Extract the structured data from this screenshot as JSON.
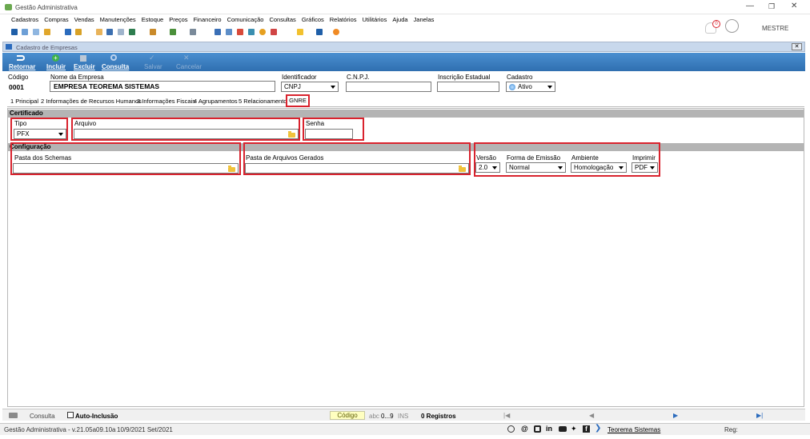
{
  "window": {
    "title": "Gestão Administrativa"
  },
  "menu": [
    "Cadastros",
    "Compras",
    "Vendas",
    "Manutenções",
    "Estoque",
    "Preços",
    "Financeiro",
    "Comunicação",
    "Consultas",
    "Gráficos",
    "Relatórios",
    "Utilitários",
    "Ajuda",
    "Janelas"
  ],
  "notification": {
    "count": "0"
  },
  "user": {
    "name": "MESTRE"
  },
  "child_window": {
    "title": "Cadastro de Empresas"
  },
  "toolbar": {
    "retornar": "Retornar",
    "incluir": "Incluir",
    "excluir": "Excluir",
    "consulta": "Consulta",
    "salvar": "Salvar",
    "cancelar": "Cancelar"
  },
  "header": {
    "codigo_label": "Código",
    "codigo_value": "0001",
    "nome_label": "Nome da Empresa",
    "nome_value": "EMPRESA TEOREMA SISTEMAS",
    "identificador_label": "Identificador",
    "identificador_value": "CNPJ",
    "cnpj_label": "C.N.P.J.",
    "ie_label": "Inscrição Estadual",
    "cadastro_label": "Cadastro",
    "cadastro_value": "Ativo"
  },
  "tabs": [
    "1 Principal",
    "2 Informações de Recursos Humanos",
    "3 Informações Fiscais",
    "4 Agrupamentos",
    "5 Relacionamentos",
    "GNRE"
  ],
  "certificado": {
    "section": "Certificado",
    "tipo_label": "Tipo",
    "tipo_value": "PFX",
    "arquivo_label": "Arquivo",
    "senha_label": "Senha"
  },
  "configuracao": {
    "section": "Configuração",
    "schemas_label": "Pasta dos Schemas",
    "gerados_label": "Pasta de Arquivos Gerados",
    "versao_label": "Versão",
    "versao_value": "2.0",
    "forma_label": "Forma de Emissão",
    "forma_value": "Normal",
    "ambiente_label": "Ambiente",
    "ambiente_value": "Homologação",
    "imprimir_label": "Imprimir",
    "imprimir_value": "PDF"
  },
  "bottom_bar": {
    "consulta": "Consulta",
    "auto_inclusao": "Auto-Inclusão",
    "codigo": "Código",
    "abc": "abc",
    "range": "0...9",
    "ins": "INS",
    "registros": "0 Registros"
  },
  "status_bar": {
    "version": "Gestão Administrativa - v.21.05a09.10a",
    "date": "10/9/2021 Set/2021",
    "company": "Teorema Sistemas",
    "reg": "Reg:"
  },
  "colors": {
    "highlight": "#d9232e",
    "title_bar": "#c8d8ec",
    "toolbar": "#3a7fc0",
    "section": "#b4b4b4"
  }
}
